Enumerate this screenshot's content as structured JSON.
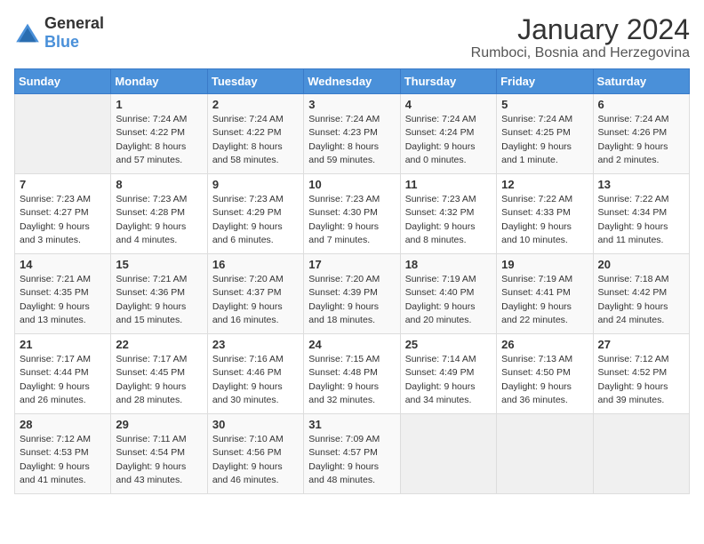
{
  "logo": {
    "general": "General",
    "blue": "Blue"
  },
  "header": {
    "month": "January 2024",
    "location": "Rumboci, Bosnia and Herzegovina"
  },
  "weekdays": [
    "Sunday",
    "Monday",
    "Tuesday",
    "Wednesday",
    "Thursday",
    "Friday",
    "Saturday"
  ],
  "weeks": [
    [
      {
        "day": "",
        "info": ""
      },
      {
        "day": "1",
        "info": "Sunrise: 7:24 AM\nSunset: 4:22 PM\nDaylight: 8 hours\nand 57 minutes."
      },
      {
        "day": "2",
        "info": "Sunrise: 7:24 AM\nSunset: 4:22 PM\nDaylight: 8 hours\nand 58 minutes."
      },
      {
        "day": "3",
        "info": "Sunrise: 7:24 AM\nSunset: 4:23 PM\nDaylight: 8 hours\nand 59 minutes."
      },
      {
        "day": "4",
        "info": "Sunrise: 7:24 AM\nSunset: 4:24 PM\nDaylight: 9 hours\nand 0 minutes."
      },
      {
        "day": "5",
        "info": "Sunrise: 7:24 AM\nSunset: 4:25 PM\nDaylight: 9 hours\nand 1 minute."
      },
      {
        "day": "6",
        "info": "Sunrise: 7:24 AM\nSunset: 4:26 PM\nDaylight: 9 hours\nand 2 minutes."
      }
    ],
    [
      {
        "day": "7",
        "info": "Sunrise: 7:23 AM\nSunset: 4:27 PM\nDaylight: 9 hours\nand 3 minutes."
      },
      {
        "day": "8",
        "info": "Sunrise: 7:23 AM\nSunset: 4:28 PM\nDaylight: 9 hours\nand 4 minutes."
      },
      {
        "day": "9",
        "info": "Sunrise: 7:23 AM\nSunset: 4:29 PM\nDaylight: 9 hours\nand 6 minutes."
      },
      {
        "day": "10",
        "info": "Sunrise: 7:23 AM\nSunset: 4:30 PM\nDaylight: 9 hours\nand 7 minutes."
      },
      {
        "day": "11",
        "info": "Sunrise: 7:23 AM\nSunset: 4:32 PM\nDaylight: 9 hours\nand 8 minutes."
      },
      {
        "day": "12",
        "info": "Sunrise: 7:22 AM\nSunset: 4:33 PM\nDaylight: 9 hours\nand 10 minutes."
      },
      {
        "day": "13",
        "info": "Sunrise: 7:22 AM\nSunset: 4:34 PM\nDaylight: 9 hours\nand 11 minutes."
      }
    ],
    [
      {
        "day": "14",
        "info": "Sunrise: 7:21 AM\nSunset: 4:35 PM\nDaylight: 9 hours\nand 13 minutes."
      },
      {
        "day": "15",
        "info": "Sunrise: 7:21 AM\nSunset: 4:36 PM\nDaylight: 9 hours\nand 15 minutes."
      },
      {
        "day": "16",
        "info": "Sunrise: 7:20 AM\nSunset: 4:37 PM\nDaylight: 9 hours\nand 16 minutes."
      },
      {
        "day": "17",
        "info": "Sunrise: 7:20 AM\nSunset: 4:39 PM\nDaylight: 9 hours\nand 18 minutes."
      },
      {
        "day": "18",
        "info": "Sunrise: 7:19 AM\nSunset: 4:40 PM\nDaylight: 9 hours\nand 20 minutes."
      },
      {
        "day": "19",
        "info": "Sunrise: 7:19 AM\nSunset: 4:41 PM\nDaylight: 9 hours\nand 22 minutes."
      },
      {
        "day": "20",
        "info": "Sunrise: 7:18 AM\nSunset: 4:42 PM\nDaylight: 9 hours\nand 24 minutes."
      }
    ],
    [
      {
        "day": "21",
        "info": "Sunrise: 7:17 AM\nSunset: 4:44 PM\nDaylight: 9 hours\nand 26 minutes."
      },
      {
        "day": "22",
        "info": "Sunrise: 7:17 AM\nSunset: 4:45 PM\nDaylight: 9 hours\nand 28 minutes."
      },
      {
        "day": "23",
        "info": "Sunrise: 7:16 AM\nSunset: 4:46 PM\nDaylight: 9 hours\nand 30 minutes."
      },
      {
        "day": "24",
        "info": "Sunrise: 7:15 AM\nSunset: 4:48 PM\nDaylight: 9 hours\nand 32 minutes."
      },
      {
        "day": "25",
        "info": "Sunrise: 7:14 AM\nSunset: 4:49 PM\nDaylight: 9 hours\nand 34 minutes."
      },
      {
        "day": "26",
        "info": "Sunrise: 7:13 AM\nSunset: 4:50 PM\nDaylight: 9 hours\nand 36 minutes."
      },
      {
        "day": "27",
        "info": "Sunrise: 7:12 AM\nSunset: 4:52 PM\nDaylight: 9 hours\nand 39 minutes."
      }
    ],
    [
      {
        "day": "28",
        "info": "Sunrise: 7:12 AM\nSunset: 4:53 PM\nDaylight: 9 hours\nand 41 minutes."
      },
      {
        "day": "29",
        "info": "Sunrise: 7:11 AM\nSunset: 4:54 PM\nDaylight: 9 hours\nand 43 minutes."
      },
      {
        "day": "30",
        "info": "Sunrise: 7:10 AM\nSunset: 4:56 PM\nDaylight: 9 hours\nand 46 minutes."
      },
      {
        "day": "31",
        "info": "Sunrise: 7:09 AM\nSunset: 4:57 PM\nDaylight: 9 hours\nand 48 minutes."
      },
      {
        "day": "",
        "info": ""
      },
      {
        "day": "",
        "info": ""
      },
      {
        "day": "",
        "info": ""
      }
    ]
  ]
}
